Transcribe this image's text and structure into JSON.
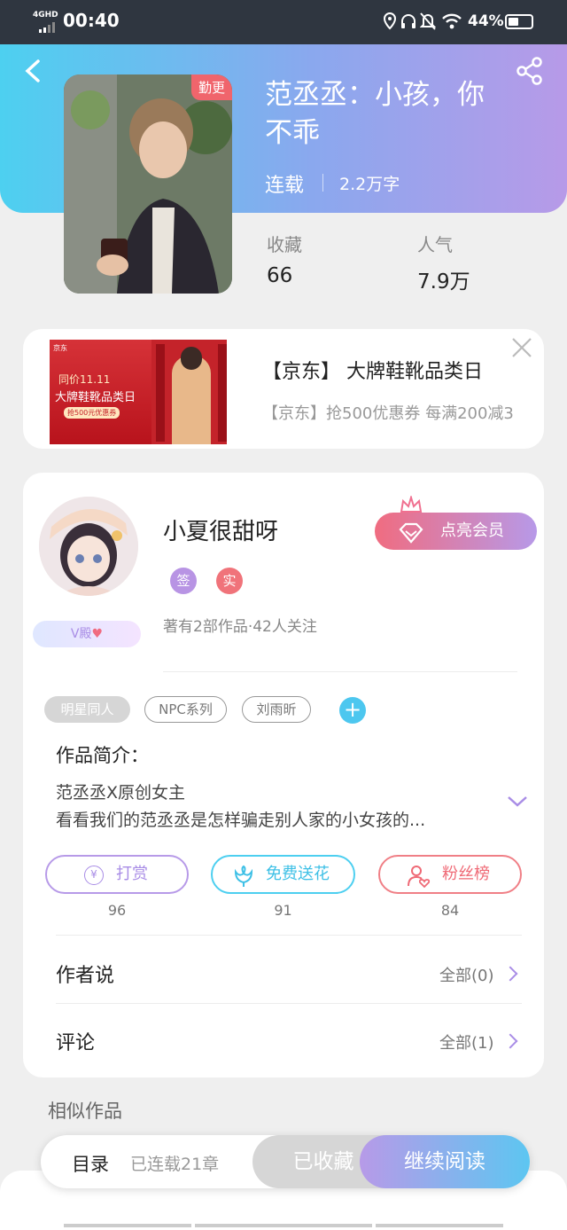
{
  "status": {
    "network": "4GHD",
    "time": "00:40",
    "battery": "44%"
  },
  "book": {
    "title_line1": "范丞丞：小孩，你",
    "title_line2": "不乖",
    "state": "连载",
    "words": "2.2万字",
    "badge": "勤更",
    "collect_label": "收藏",
    "collect_value": "66",
    "popularity_label": "人气",
    "popularity_value": "7.9万"
  },
  "ad": {
    "title": "【京东】 大牌鞋靴品类日",
    "subtitle": "【京东】抢500优惠券 每满200减3",
    "thumb": {
      "brand": "京东",
      "line1": "同价11.11",
      "line2": "大牌鞋靴品类日",
      "line3": "抢500元优惠券"
    }
  },
  "author": {
    "name": "小夏很甜呀",
    "badge_sign": "签",
    "badge_real": "实",
    "vip_label": "V殿",
    "member_button": "点亮会员",
    "stats": "著有2部作品·42人关注"
  },
  "tags": [
    "明星同人",
    "NPC系列",
    "刘雨昕"
  ],
  "intro": {
    "heading": "作品简介：",
    "line1": "范丞丞X原创女主",
    "line2": "看看我们的范丞丞是怎样骗走别人家的小女孩的..."
  },
  "actions": [
    {
      "label": "打赏",
      "count": "96"
    },
    {
      "label": "免费送花",
      "count": "91"
    },
    {
      "label": "粉丝榜",
      "count": "84"
    }
  ],
  "sections": {
    "author_say": "作者说",
    "author_say_all": "全部(0)",
    "comments": "评论",
    "comments_all": "全部(1)"
  },
  "similar": "相似作品",
  "bottom": {
    "catalog": "目录",
    "chapters": "已连载21章",
    "collected": "已收藏",
    "continue": "继续阅读"
  },
  "colors": {
    "accent_purple": "#a98de6",
    "accent_pink": "#f06b80",
    "accent_cyan": "#4dd0f0"
  }
}
